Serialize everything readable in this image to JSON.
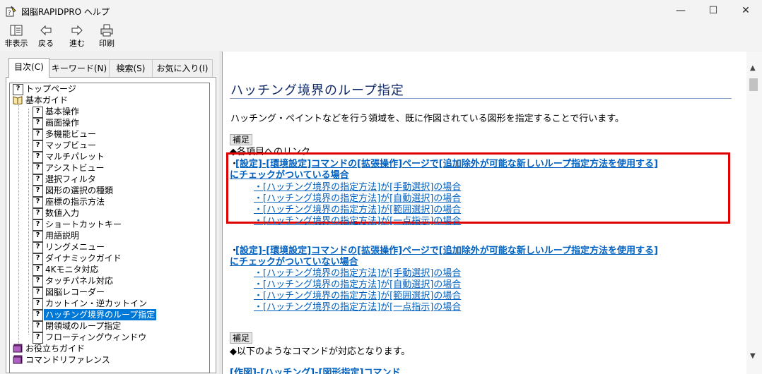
{
  "window": {
    "title": "図脳RAPIDPRO ヘルプ",
    "minimize": "—",
    "maximize": "☐",
    "close": "✕"
  },
  "toolbar": {
    "hide": "非表示",
    "back": "戻る",
    "forward": "進む",
    "print": "印刷"
  },
  "tabs": {
    "contents": "目次(C)",
    "keyword": "キーワード(N)",
    "search": "検索(S)",
    "favorites": "お気に入り(I)"
  },
  "tree": {
    "top": "トップページ",
    "basic_guide": "基本ガイド",
    "children": [
      "基本操作",
      "画面操作",
      "多機能ビュー",
      "マップビュー",
      "マルチパレット",
      "アシストビュー",
      "選択フィルタ",
      "図形の選択の種類",
      "座標の指示方法",
      "数値入力",
      "ショートカットキー",
      "用語説明",
      "リングメニュー",
      "ダイナミックガイド",
      "4Kモニタ対応",
      "タッチパネル対応",
      "図脳レコーダー",
      "カットイン・逆カットイン",
      "ハッチング境界のループ指定",
      "閉領域のループ指定",
      "フローティングウィンドウ"
    ],
    "useful_guide": "お役立ちガイド",
    "command_ref": "コマンドリファレンス"
  },
  "content": {
    "title": "ハッチング境界のループ指定",
    "intro": "ハッチング・ペイントなどを行う領域を、既に作図されている図形を指定することで行います。",
    "hosoku": "補足",
    "links_heading": "◆各項目へのリンク",
    "bullet": "・",
    "section1": {
      "line1": "[設定]-[環境設定]コマンドの[拡張操作]ページで[追加除外が可能な新しいループ指定方法を使用する]",
      "line2": "にチェックがついている場合",
      "items": [
        "・[ハッチング境界の指定方法]が[手動選択]の場合",
        "・[ハッチング境界の指定方法]が[自動選択]の場合",
        "・[ハッチング境界の指定方法]が[範囲選択]の場合",
        "・[ハッチング境界の指定方法]が[一点指示]の場合"
      ]
    },
    "section2": {
      "line1": "[設定]-[環境設定]コマンドの[拡張操作]ページで[追加除外が可能な新しいループ指定方法を使用する]",
      "line2": "にチェックがついていない場合",
      "items": [
        "・[ハッチング境界の指定方法]が[手動選択]の場合",
        "・[ハッチング境界の指定方法]が[自動選択]の場合",
        "・[ハッチング境界の指定方法]が[範囲選択]の場合",
        "・[ハッチング境界の指定方法]が[一点指示]の場合"
      ]
    },
    "hosoku2": "補足",
    "commands_heading": "◆以下のようなコマンドが対応となります。",
    "cut_line": "[作図]-[ハッチング]-[図形指定]コマンド"
  },
  "colors": {
    "link": "#0060c0",
    "title": "#102a68",
    "highlight_box": "#e00000",
    "selected": "#0078d7"
  }
}
